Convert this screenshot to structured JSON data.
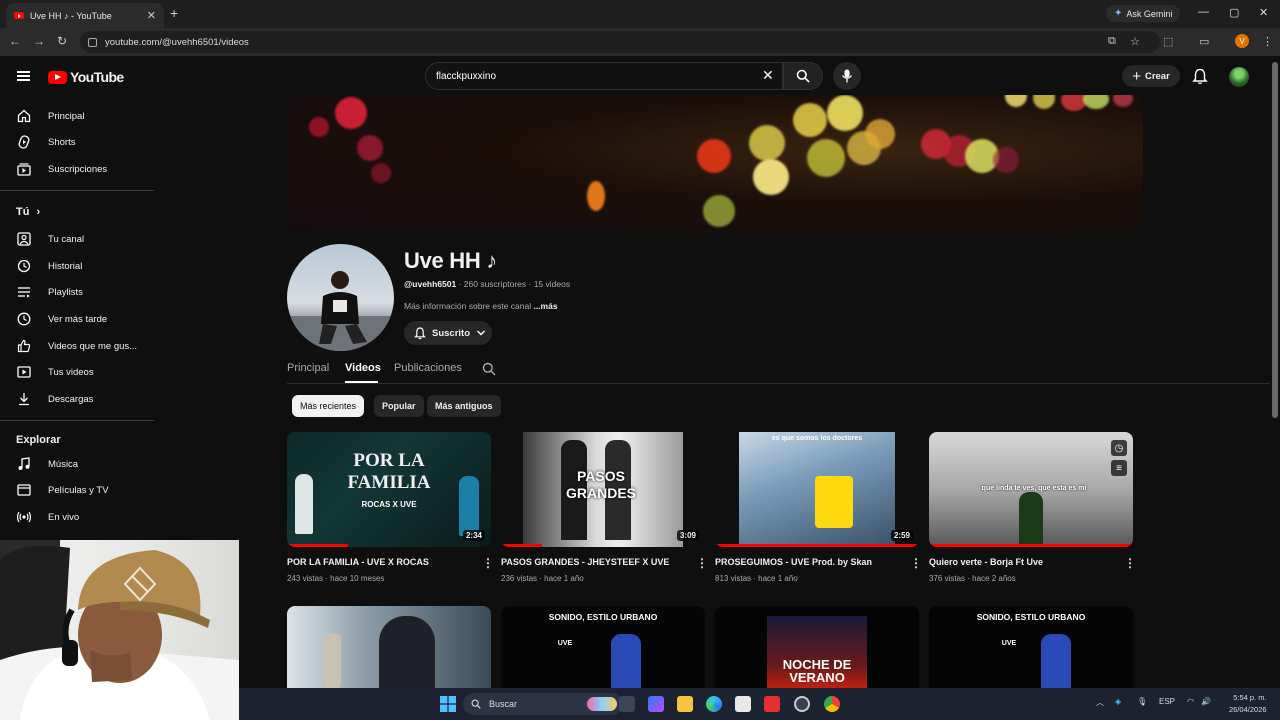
{
  "browser": {
    "tab_title": "Uve HH ♪ - YouTube",
    "tab_close": "✕",
    "new_tab": "+",
    "gemini_label": "Ask Gemini",
    "url": "youtube.com/@uvehh6501/videos",
    "profile_initial": "V",
    "window_controls": [
      "—",
      "▢",
      "✕"
    ]
  },
  "header": {
    "logo_text": "YouTube",
    "search_value": "flacckpuxxino",
    "create_label": "Crear",
    "create_plus": "+"
  },
  "sidebar": {
    "main_items": [
      {
        "label": "Principal",
        "icon": "home-icon"
      },
      {
        "label": "Shorts",
        "icon": "shorts-icon"
      },
      {
        "label": "Suscripciones",
        "icon": "subscriptions-icon"
      }
    ],
    "you_heading": "Tú",
    "you_chevron": "›",
    "you_items": [
      {
        "label": "Tu canal",
        "icon": "channel-icon"
      },
      {
        "label": "Historial",
        "icon": "history-icon"
      },
      {
        "label": "Playlists",
        "icon": "playlists-icon"
      },
      {
        "label": "Ver más tarde",
        "icon": "watch-later-icon"
      },
      {
        "label": "Videos que me gus...",
        "icon": "like-icon"
      },
      {
        "label": "Tus videos",
        "icon": "your-videos-icon"
      },
      {
        "label": "Descargas",
        "icon": "download-icon"
      }
    ],
    "explore_heading": "Explorar",
    "explore_items": [
      {
        "label": "Música",
        "icon": "music-icon"
      },
      {
        "label": "Películas y TV",
        "icon": "movies-icon"
      },
      {
        "label": "En vivo",
        "icon": "live-icon"
      }
    ]
  },
  "channel": {
    "name": "Uve HH ♪",
    "handle": "@uvehh6501",
    "stats": " · 260 suscriptores · 15 videos",
    "description": "Más información sobre este canal ",
    "more": "...más",
    "subscribed_label": "Suscrito",
    "tabs": [
      "Principal",
      "Videos",
      "Publicaciones"
    ],
    "active_tab": "Videos"
  },
  "chips": [
    "Más recientes",
    "Popular",
    "Más antiguos"
  ],
  "active_chip": "Más recientes",
  "videos": [
    {
      "title": "POR LA FAMILIA - UVE X ROCAS",
      "views": "243 vistas",
      "age": "hace 10 meses",
      "duration": "2:34",
      "thumb_text": "POR LA FAMILIA",
      "thumb_sub": "ROCAS X UVE",
      "watched": 0.3
    },
    {
      "title": "PASOS GRANDES - JHEYSTEEF X UVE",
      "views": "236 vistas",
      "age": "hace 1 año",
      "duration": "3:09",
      "thumb_text": "PASOS GRANDES",
      "thumb_sub": "",
      "watched": 0.2
    },
    {
      "title": "PROSEGUIMOS - UVE Prod. by Skan",
      "views": "813 vistas",
      "age": "hace 1 año",
      "duration": "2:59",
      "thumb_text": "es que somos los doctores",
      "thumb_sub": "",
      "watched": 1.0
    },
    {
      "title": "Quiero verte - Borja Ft Uve",
      "views": "376 vistas",
      "age": "hace 2 años",
      "duration": "",
      "thumb_text": "que linda te ves, que esta es mi",
      "thumb_sub": "",
      "watched": 1.0
    }
  ],
  "row2_thumbs": [
    {
      "thumb_text": ""
    },
    {
      "thumb_text": "SONIDO, ESTILO URBANO",
      "thumb_sub": "UVE"
    },
    {
      "thumb_text": "NOCHE DE VERANO"
    },
    {
      "thumb_text": "SONIDO, ESTILO URBANO",
      "thumb_sub": "UVE"
    }
  ],
  "taskbar": {
    "search_label": "Buscar",
    "language": "ESP",
    "time": "5:54 p. m.",
    "date": "26/04/2026"
  },
  "colors": {
    "background": "#0f0f0f",
    "brand_red": "#ff0000",
    "text_secondary": "#aaaaaa"
  }
}
